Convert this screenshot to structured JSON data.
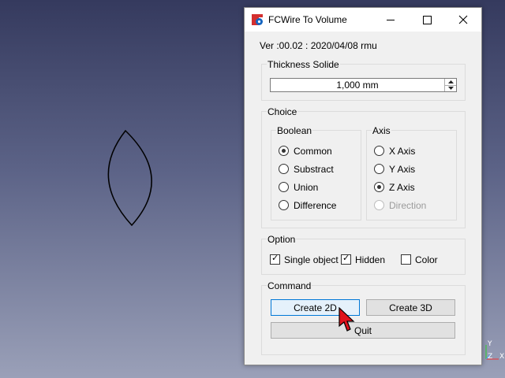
{
  "window": {
    "title": "FCWire To Volume"
  },
  "version_text": "Ver :00.02 : 2020/04/08 rmu",
  "thickness": {
    "legend": "Thickness Solide",
    "value": "1,000 mm"
  },
  "choice": {
    "legend": "Choice",
    "boolean": {
      "legend": "Boolean",
      "options": [
        "Common",
        "Substract",
        "Union",
        "Difference"
      ],
      "selected": "Common"
    },
    "axis": {
      "legend": "Axis",
      "options": [
        "X Axis",
        "Y Axis",
        "Z Axis",
        "Direction"
      ],
      "selected": "Z Axis",
      "disabled": [
        "Direction"
      ]
    }
  },
  "option": {
    "legend": "Option",
    "single_object": {
      "label": "Single object",
      "checked": true
    },
    "hidden": {
      "label": "Hidden",
      "checked": true
    },
    "color": {
      "label": "Color",
      "checked": false
    }
  },
  "command": {
    "legend": "Command",
    "create_2d": "Create 2D",
    "create_3d": "Create 3D",
    "quit": "Quit"
  },
  "axis_indicator": {
    "y": "Y",
    "z": "Z",
    "x": "X"
  },
  "colors": {
    "viewport_top": "#353a5e",
    "viewport_bottom": "#9aa0b8",
    "focus_blue": "#0078d7",
    "cursor_red": "#e0121b"
  }
}
